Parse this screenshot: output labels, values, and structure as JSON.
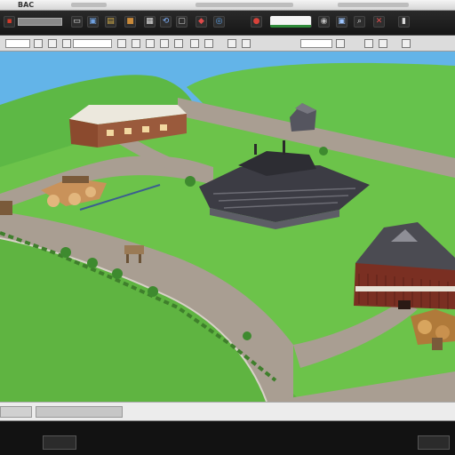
{
  "window": {
    "title": "BAC"
  },
  "toolbar": {
    "icons": [
      {
        "name": "new-file-icon",
        "glyph": "▪",
        "color": "#d23a2a"
      },
      {
        "name": "open-icon",
        "glyph": "▭",
        "color": "#e6e6e6"
      },
      {
        "name": "layer-icon",
        "glyph": "▣",
        "color": "#6fa0e0"
      },
      {
        "name": "image-icon",
        "glyph": "▤",
        "color": "#d7b04a"
      },
      {
        "name": "folder-icon",
        "glyph": "■",
        "color": "#c98a3a"
      },
      {
        "name": "grid-icon",
        "glyph": "▦",
        "color": "#e0e0e0"
      },
      {
        "name": "rotate-icon",
        "glyph": "⟲",
        "color": "#7fb2ff"
      },
      {
        "name": "select-icon",
        "glyph": "▢",
        "color": "#cfcfcf"
      },
      {
        "name": "marker-icon",
        "glyph": "◆",
        "color": "#e04a4a"
      },
      {
        "name": "globe-icon",
        "glyph": "◎",
        "color": "#5ca0e6"
      },
      {
        "name": "pin-icon",
        "glyph": "●",
        "color": "#d8423a"
      },
      {
        "name": "tag-icon",
        "glyph": "▰",
        "color": "#d6d6d6"
      },
      {
        "name": "camera-icon",
        "glyph": "◉",
        "color": "#bbbbbb"
      },
      {
        "name": "view-icon",
        "glyph": "▣",
        "color": "#9ec6ff"
      },
      {
        "name": "zoom-icon",
        "glyph": "⌕",
        "color": "#dddddd"
      },
      {
        "name": "delete-icon",
        "glyph": "✕",
        "color": "#e05050"
      },
      {
        "name": "save-icon",
        "glyph": "▮",
        "color": "#d9d9d9"
      }
    ]
  },
  "statusbar": {
    "text": ""
  },
  "taskbar": {
    "items": [
      {
        "label": ""
      },
      {
        "label": ""
      }
    ]
  },
  "colors": {
    "sky": "#63b4e8",
    "grass": "#6cc34a",
    "grass_dark": "#4fa83a",
    "road": "#a99e92",
    "roof_red": "#7a2f22",
    "toolbar": "#1f1f1f"
  }
}
